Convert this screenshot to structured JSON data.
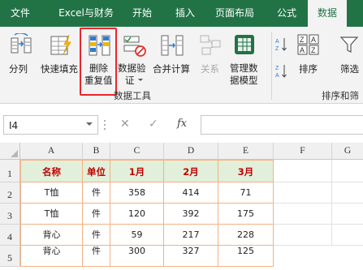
{
  "tabs": [
    {
      "label": "文件",
      "active": false
    },
    {
      "label": "Excel与财务",
      "active": false
    },
    {
      "label": "开始",
      "active": false
    },
    {
      "label": "插入",
      "active": false
    },
    {
      "label": "页面布局",
      "active": false
    },
    {
      "label": "公式",
      "active": false
    },
    {
      "label": "数据",
      "active": true
    },
    {
      "label": "",
      "active": false
    }
  ],
  "ribbon": {
    "split": "分列",
    "flash_fill": "快速填充",
    "remove_dup_line1": "删除",
    "remove_dup_line2": "重复值",
    "validation_line1": "数据验",
    "validation_line2": "证",
    "consolidate": "合并计算",
    "relations": "关系",
    "data_model_line1": "管理数",
    "data_model_line2": "据模型",
    "sort": "排序",
    "filter": "筛选",
    "group_data_tools": "数据工具",
    "group_sort_filter": "排序和筛"
  },
  "formula_bar": {
    "name_box": "I4",
    "cancel": "✕",
    "enter": "✓",
    "fx": "fx",
    "value": ""
  },
  "sheet": {
    "columns": [
      "A",
      "B",
      "C",
      "D",
      "E",
      "F",
      "G"
    ],
    "rows": [
      "1",
      "2",
      "3",
      "4",
      "5"
    ],
    "header": [
      "名称",
      "单位",
      "1月",
      "2月",
      "3月"
    ],
    "data": [
      [
        "T恤",
        "件",
        "358",
        "414",
        "71"
      ],
      [
        "T恤",
        "件",
        "120",
        "392",
        "175"
      ],
      [
        "背心",
        "件",
        "59",
        "217",
        "228"
      ],
      [
        "背心",
        "件",
        "300",
        "327",
        "125"
      ]
    ]
  },
  "colors": {
    "brand": "#217346",
    "header_fill": "#e2efda",
    "header_text": "#c00000",
    "table_border": "#f4b183",
    "highlight": "#e8262b"
  }
}
